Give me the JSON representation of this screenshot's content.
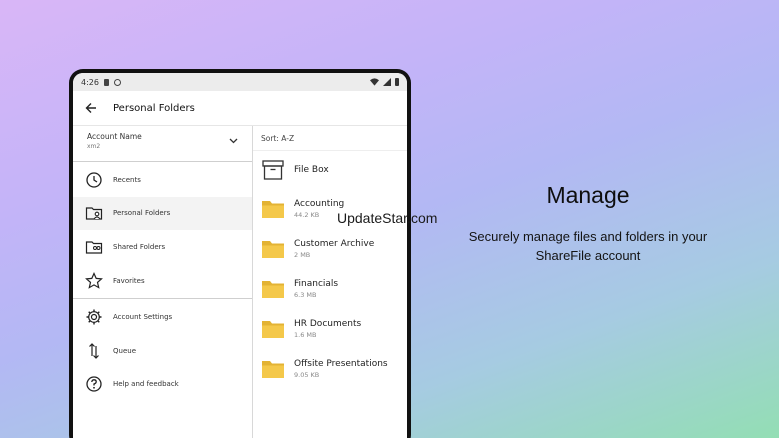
{
  "status": {
    "time": "4:26"
  },
  "appbar": {
    "title": "Personal Folders"
  },
  "account": {
    "name": "Account Name",
    "sub": "xm2"
  },
  "nav_group1": [
    {
      "label": "Recents",
      "icon": "clock-icon"
    },
    {
      "label": "Personal Folders",
      "icon": "personal-folder-icon",
      "active": true
    },
    {
      "label": "Shared Folders",
      "icon": "shared-folder-icon"
    },
    {
      "label": "Favorites",
      "icon": "star-icon"
    }
  ],
  "nav_group2": [
    {
      "label": "Account Settings",
      "icon": "gear-icon"
    },
    {
      "label": "Queue",
      "icon": "up-down-arrows-icon"
    },
    {
      "label": "Help and feedback",
      "icon": "help-icon"
    }
  ],
  "sort": {
    "label": "Sort: A-Z"
  },
  "filebox": {
    "name": "File Box"
  },
  "files": [
    {
      "name": "Accounting",
      "size": "44.2 KB"
    },
    {
      "name": "Customer Archive",
      "size": "2 MB"
    },
    {
      "name": "Financials",
      "size": "6.3 MB"
    },
    {
      "name": "HR Documents",
      "size": "1.6 MB"
    },
    {
      "name": "Offsite Presentations",
      "size": "9.05 KB"
    }
  ],
  "marketing": {
    "headline": "Manage",
    "subline": "Securely manage files and folders in your ShareFile account"
  },
  "watermark": "UpdateStar.com",
  "colors": {
    "folder": "#f4c84a",
    "folder_dark": "#e3b334"
  }
}
